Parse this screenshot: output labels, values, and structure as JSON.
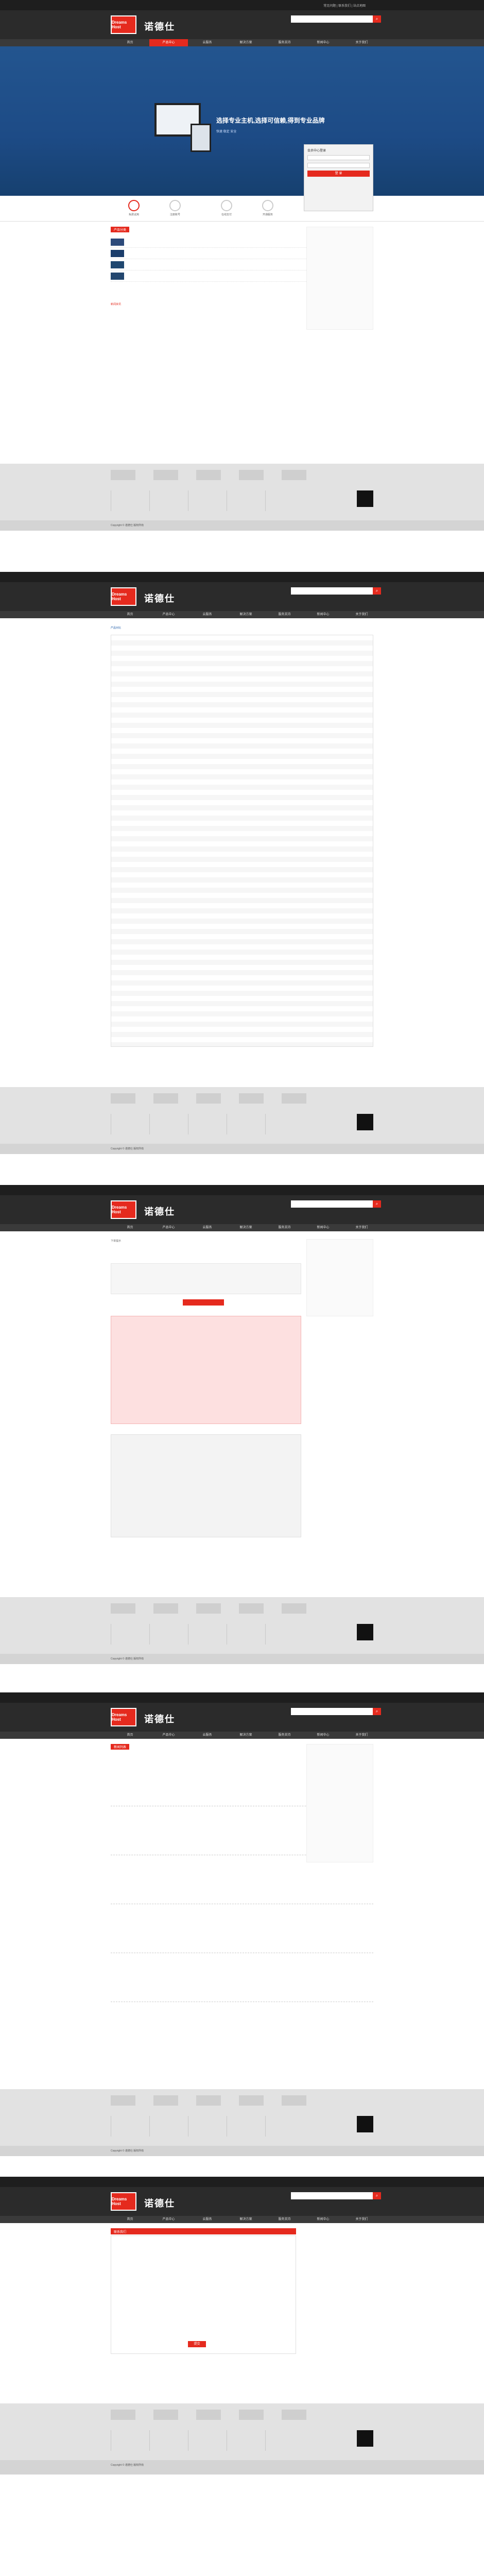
{
  "site": {
    "logo_text": "Dreams Host",
    "logo_cn": "诺德仕",
    "topbar_links": "常见问题 | 联系我们 | 站点地图",
    "login": "登录 | 注册",
    "hotline": "全国热线",
    "search_icon": "search-icon"
  },
  "nav": [
    "首页",
    "产品中心",
    "云服务",
    "解决方案",
    "服务支持",
    "新闻中心",
    "关于我们"
  ],
  "banner": {
    "headline": "选择专业主机,选择可信赖,得到专业品牌",
    "sub": "快速  稳定  安全"
  },
  "login_panel": {
    "title": "会员中心登录",
    "button": "登 录"
  },
  "steps": [
    "免费试用",
    "注册账号",
    "在线支付",
    "开通服务"
  ],
  "products": {
    "title": "产品分类",
    "label": "主机产品"
  },
  "news_title": "新闻资讯",
  "compare_heading": "产品对比",
  "order_heading": "下单提示",
  "news_list_heading": "新闻列表",
  "contact_heading": "联系我们",
  "contact_button": "提交",
  "footer": {
    "copyright": "Copyright © 诺德仕 版权所有"
  }
}
